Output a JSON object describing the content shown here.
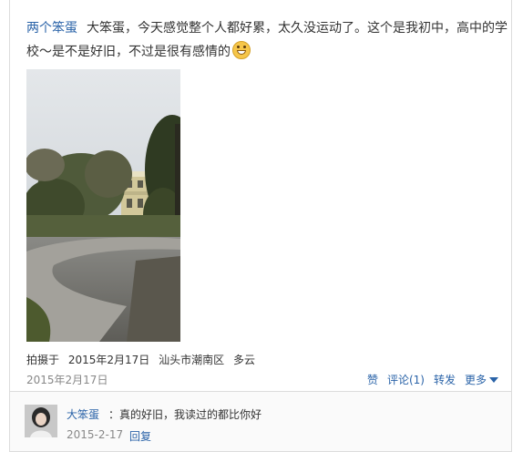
{
  "post": {
    "author": "两个笨蛋",
    "text": "大笨蛋，今天感觉整个人都好累，太久没运动了。这个是我初中，高中的学校～是不是好旧，不过是很有感情的",
    "emoji_icon": "grin-emoji-icon",
    "photo_alt": "school-building-photo",
    "meta_prefix": "拍摄于",
    "meta_date": "2015年2月17日",
    "meta_location": "汕头市潮南区",
    "meta_weather": "多云",
    "date": "2015年2月17日"
  },
  "actions": {
    "like": "赞",
    "comment": "评论(1)",
    "repost": "转发",
    "more": "更多"
  },
  "comments": [
    {
      "author": "大笨蛋",
      "text": "：真的好旧，我读过的都比你好",
      "date": "2015-2-17",
      "reply_label": "回复"
    }
  ],
  "colors": {
    "link": "#2a63a8",
    "muted": "#888888",
    "border": "#dcdcdc"
  }
}
